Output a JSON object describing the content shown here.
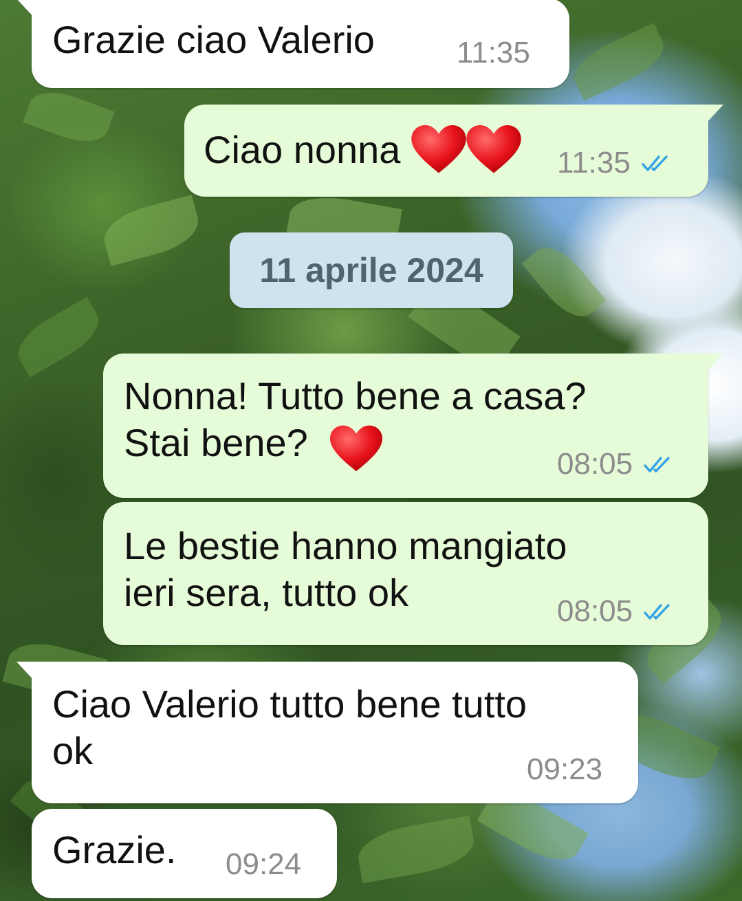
{
  "chat": {
    "date_separator": "11 aprile 2024",
    "messages": [
      {
        "direction": "incoming",
        "text": "Grazie ciao Valerio",
        "time": "11:35"
      },
      {
        "direction": "outgoing",
        "text": "Ciao nonna ",
        "emoji": "red-heart x2",
        "time": "11:35",
        "status": "read"
      },
      {
        "direction": "outgoing",
        "text": "Nonna! Tutto bene a casa?\nStai bene?",
        "emoji": "red-heart",
        "time": "08:05",
        "status": "read"
      },
      {
        "direction": "outgoing",
        "text": "Le bestie hanno mangiato\nieri sera, tutto ok",
        "time": "08:05",
        "status": "read"
      },
      {
        "direction": "incoming",
        "text": "Ciao Valerio tutto bene tutto\nok",
        "time": "09:23"
      },
      {
        "direction": "incoming",
        "text": "Grazie.",
        "time": "09:24"
      }
    ]
  },
  "colors": {
    "incoming_bubble": "#ffffff",
    "outgoing_bubble": "#e6fcd8",
    "timestamp": "#8c8c8c",
    "read_ticks": "#34a3e6",
    "date_chip": "#cfe3ef",
    "date_chip_text": "#4f6470"
  },
  "icons": {
    "read_status": "double-check-icon",
    "emoji": "red-heart-icon"
  }
}
